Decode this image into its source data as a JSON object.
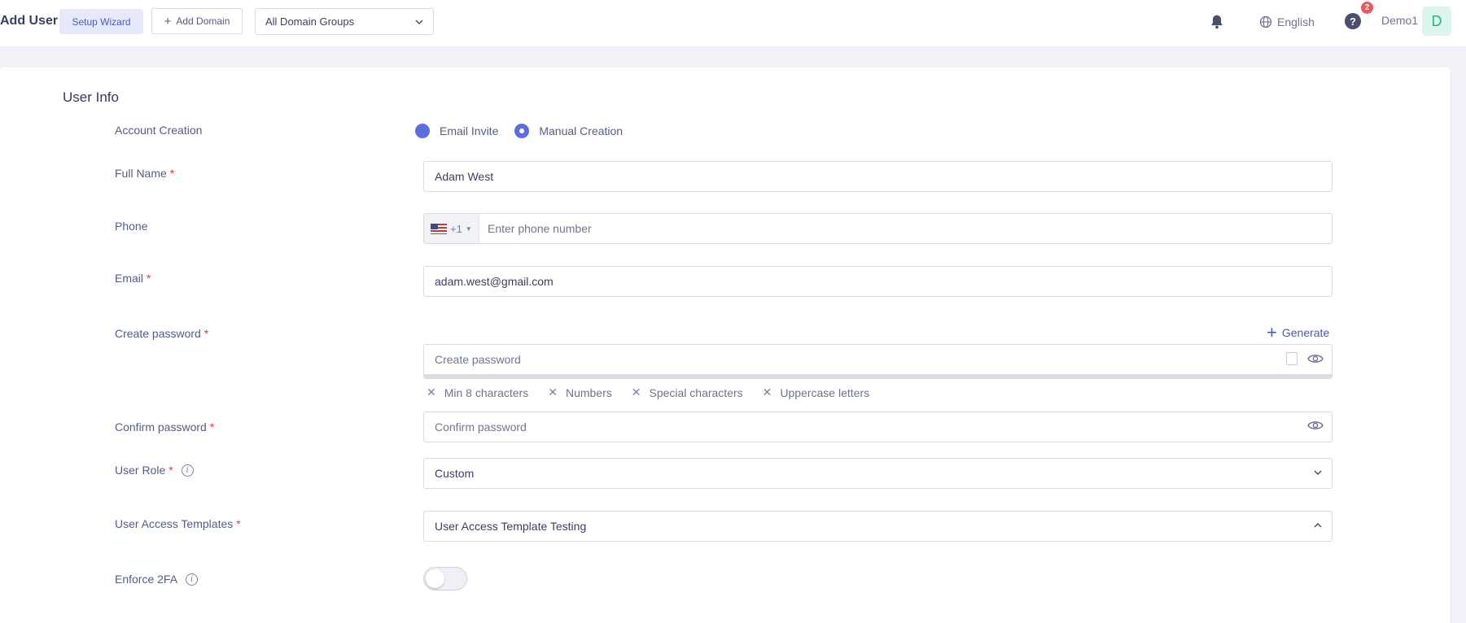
{
  "header": {
    "title": "Add User",
    "setup_wizard": "Setup Wizard",
    "add_domain": "Add Domain",
    "domain_group": "All Domain Groups",
    "language": "English",
    "help_badge": "2",
    "user_name": "Demo1",
    "avatar_letter": "D"
  },
  "form": {
    "section_title": "User Info",
    "account_creation": {
      "label": "Account Creation",
      "options": [
        "Email Invite",
        "Manual Creation"
      ],
      "selected": "Manual Creation"
    },
    "full_name": {
      "label": "Full Name",
      "value": "Adam West"
    },
    "phone": {
      "label": "Phone",
      "country_code": "+1",
      "placeholder": "Enter phone number"
    },
    "email": {
      "label": "Email",
      "value": "adam.west@gmail.com"
    },
    "create_password": {
      "label": "Create password",
      "placeholder": "Create password",
      "generate": "Generate",
      "rules": [
        "Min 8 characters",
        "Numbers",
        "Special characters",
        "Uppercase letters"
      ]
    },
    "confirm_password": {
      "label": "Confirm password",
      "placeholder": "Confirm password"
    },
    "user_role": {
      "label": "User Role",
      "value": "Custom"
    },
    "user_access_templates": {
      "label": "User Access Templates",
      "value": "User Access Template Testing"
    },
    "enforce_2fa": {
      "label": "Enforce 2FA",
      "enabled": false
    }
  },
  "colors": {
    "accent": "#5b6ee1",
    "required": "#e03b3b",
    "badge": "#ea5a5a",
    "avatar_bg": "#dcf6ee"
  }
}
